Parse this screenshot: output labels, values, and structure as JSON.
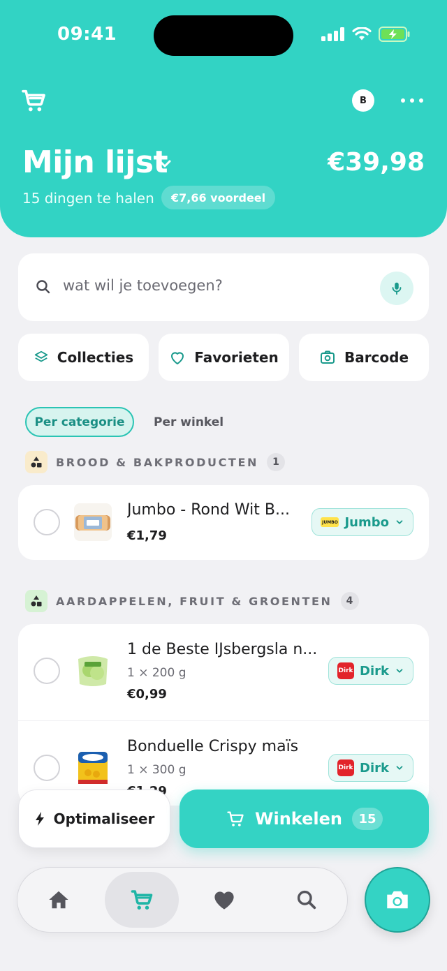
{
  "status_bar": {
    "time": "09:41"
  },
  "header": {
    "list_title": "Mijn lijst",
    "total": "€39,98",
    "items_to_get": "15 dingen te halen",
    "savings": "€7,66 voordeel",
    "avatar_initial": "B"
  },
  "search": {
    "placeholder": "wat wil je toevoegen?",
    "value": ""
  },
  "quick_actions": {
    "collections": "Collecties",
    "favorites": "Favorieten",
    "barcode": "Barcode"
  },
  "view_toggle": {
    "by_category": "Per categorie",
    "by_store": "Per winkel",
    "selected": "Per categorie"
  },
  "categories": [
    {
      "label": "BROOD & BAKPRODUCTEN",
      "count": "1",
      "items": [
        {
          "name": "Jumbo - Rond Wit B...",
          "qty": "",
          "price": "€1,79",
          "store": "Jumbo",
          "store_logo": "JUMBO"
        }
      ]
    },
    {
      "label": "AARDAPPELEN, FRUIT & GROENTEN",
      "count": "4",
      "items": [
        {
          "name": "1 de Beste IJsbergsla n...",
          "qty": "1 × 200 g",
          "price": "€0,99",
          "store": "Dirk",
          "store_logo": "Dirk"
        },
        {
          "name": "Bonduelle Crispy maïs",
          "qty": "1 × 300 g",
          "price": "€1,29",
          "store": "Dirk",
          "store_logo": "Dirk"
        }
      ]
    }
  ],
  "bottom_actions": {
    "optimize": "Optimaliseer",
    "shop": "Winkelen",
    "shop_count": "15"
  },
  "tab_bar": [
    "home-icon",
    "cart-icon",
    "heart-icon",
    "search-icon"
  ],
  "colors": {
    "accent": "#32d3c4",
    "jumbo": "#ffe24a",
    "dirk": "#e2232a"
  }
}
